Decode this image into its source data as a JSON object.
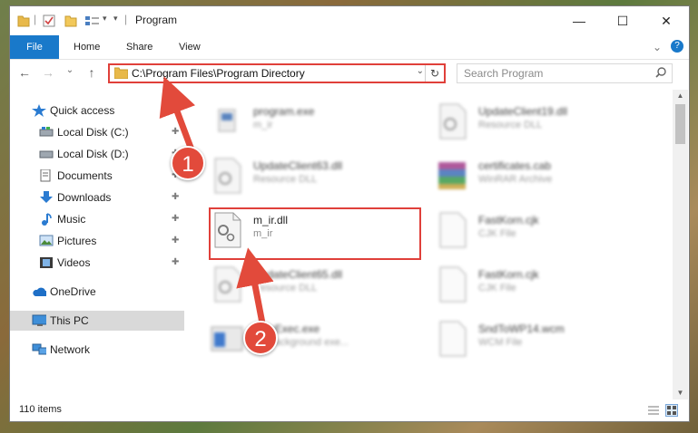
{
  "window": {
    "title": "Program",
    "minimize": "—",
    "maximize": "☐",
    "close": "✕"
  },
  "ribbon": {
    "tabs": [
      "File",
      "Home",
      "Share",
      "View"
    ],
    "expand": "⌄",
    "help": "?"
  },
  "nav": {
    "back": "←",
    "forward": "→",
    "recent": "⌄",
    "up": "↑",
    "address": "C:\\Program Files\\Program Directory",
    "search_placeholder": "Search Program"
  },
  "sidebar": {
    "items": [
      {
        "label": "Quick access",
        "icon": "star-icon",
        "pinned": false
      },
      {
        "label": "Local Disk (C:)",
        "icon": "drive-icon",
        "pinned": true
      },
      {
        "label": "Local Disk (D:)",
        "icon": "drive-icon",
        "pinned": true
      },
      {
        "label": "Documents",
        "icon": "documents-icon",
        "pinned": true
      },
      {
        "label": "Downloads",
        "icon": "download-icon",
        "pinned": true
      },
      {
        "label": "Music",
        "icon": "music-icon",
        "pinned": true
      },
      {
        "label": "Pictures",
        "icon": "pictures-icon",
        "pinned": true
      },
      {
        "label": "Videos",
        "icon": "videos-icon",
        "pinned": true
      },
      {
        "label": "OneDrive",
        "icon": "cloud-icon",
        "pinned": false
      },
      {
        "label": "This PC",
        "icon": "computer-icon",
        "pinned": false,
        "selected": true
      },
      {
        "label": "Network",
        "icon": "network-icon",
        "pinned": false
      }
    ],
    "pin_glyph": "📌"
  },
  "files": [
    {
      "name": "program.exe",
      "type": "m_ir",
      "icon": "exe-icon",
      "blurred": true
    },
    {
      "name": "UpdateClient19.dll",
      "type": "Resource DLL",
      "icon": "dll-icon",
      "blurred": true
    },
    {
      "name": "UpdateClient63.dll",
      "type": "Resource DLL",
      "icon": "dll-icon",
      "blurred": true
    },
    {
      "name": "certificates.cab",
      "type": "WinRAR Archive",
      "icon": "winrar-icon",
      "blurred": true
    },
    {
      "name": "m_ir.dll",
      "type": "m_ir",
      "icon": "dll-icon",
      "blurred": false
    },
    {
      "name": "FastKorn.cjk",
      "type": "CJK File",
      "icon": "blank-file-icon",
      "blurred": true
    },
    {
      "name": "UpdateClient65.dll",
      "type": "Resource DLL",
      "icon": "dll-icon",
      "blurred": true
    },
    {
      "name": "FastKorn.cjk",
      "type": "CJK File",
      "icon": "blank-file-icon",
      "blurred": true
    },
    {
      "name": "VideExec.exe",
      "type": "EY background exe...",
      "icon": "exe-window-icon",
      "blurred": true
    },
    {
      "name": "SndToWP14.wcm",
      "type": "WCM File",
      "icon": "blank-file-icon",
      "blurred": true
    }
  ],
  "status": {
    "count": "110 items"
  },
  "callouts": {
    "one": "1",
    "two": "2"
  },
  "colors": {
    "accent": "#1979ca",
    "highlight": "#e0403a",
    "arrow": "#e24a3b"
  }
}
